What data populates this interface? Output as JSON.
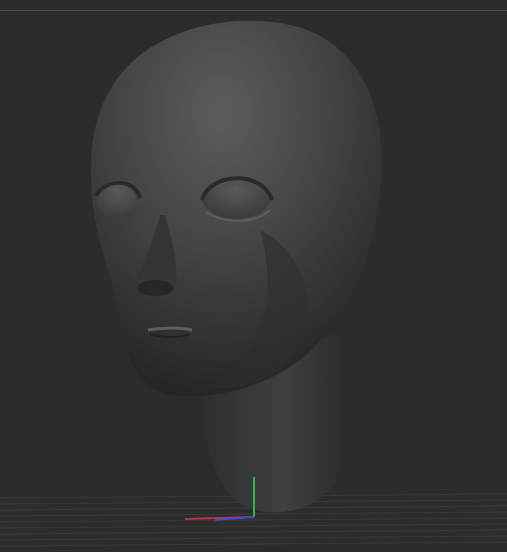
{
  "viewport": {
    "background": "#2c2c2c",
    "border_color": "#4a4a4a",
    "grid_color": "#3a3a3a"
  },
  "model": {
    "material_color": "#3f3f3f",
    "highlight_color": "#5a5a5a"
  },
  "gizmo": {
    "x_axis_color": "#c0304a",
    "y_axis_color": "#2fb84a",
    "z_axis_color": "#3a50d0"
  }
}
